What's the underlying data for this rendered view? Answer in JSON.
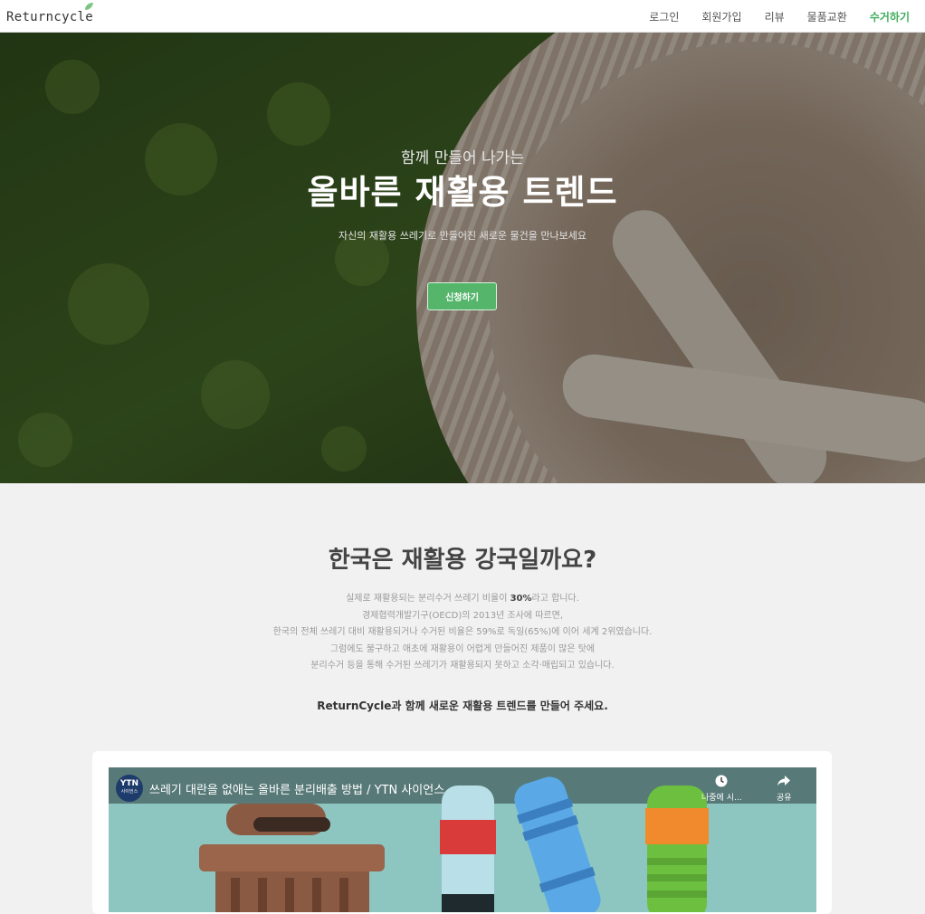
{
  "header": {
    "logo": "Returncycle",
    "nav": [
      {
        "label": "로그인"
      },
      {
        "label": "회원가입"
      },
      {
        "label": "리뷰"
      },
      {
        "label": "물품교환"
      },
      {
        "label": "수거하기",
        "active": true
      }
    ]
  },
  "hero": {
    "subtitle": "함께 만들어 나가는",
    "title": "올바른 재활용 트렌드",
    "description": "자신의 재활용 쓰레기로 만들어진 새로운 물건을 만나보세요",
    "button_label": "신청하기"
  },
  "info": {
    "title": "한국은 재활용 강국일까요?",
    "line1_pre": "실제로 재활용되는 분리수거 쓰레기 비율이 ",
    "line1_bold": "30%",
    "line1_post": "라고 합니다.",
    "line2": "경제협력개발기구(OECD)의 2013년 조사에 따르면,",
    "line3": "한국의 전체 쓰레기 대비 재활용되거나 수거된 비율은 59%로 독일(65%)에 이어 세계 2위였습니다.",
    "line4": "그럼에도 불구하고 애초에 재활용이 어렵게 만들어진 제품이 많은 탓에",
    "line5": "분리수거 등을 통해 수거된 쓰레기가 재활용되지 못하고 소각·매립되고 있습니다.",
    "cta": "ReturnCycle과 함께 새로운 재활용 트렌드를 만들어 주세요."
  },
  "video": {
    "channel_logo": "YTN",
    "channel_logo_sub": "사이언스",
    "title": "쓰레기 대란을 없애는 올바른 분리배출 방법 / YTN 사이언스",
    "watch_later": "나중에 시...",
    "share": "공유"
  },
  "colors": {
    "accent": "#3fae5d",
    "button": "#55b56b"
  }
}
